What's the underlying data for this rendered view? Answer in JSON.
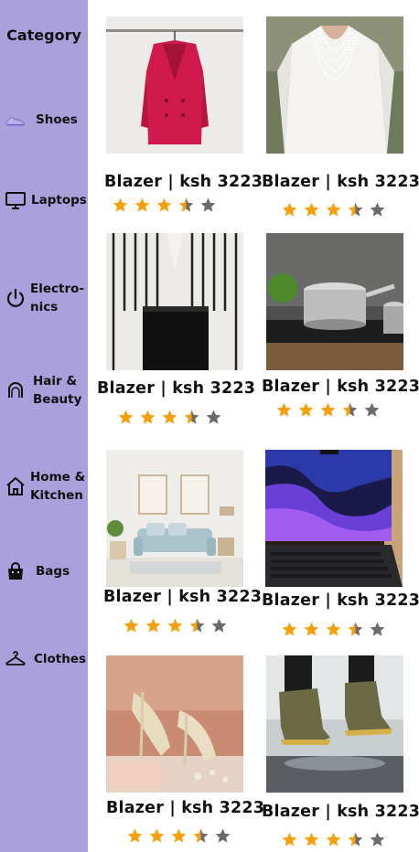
{
  "sidebar": {
    "title": "Category",
    "items": [
      {
        "label": "Shoes",
        "icon": "sneaker-icon"
      },
      {
        "label": "Laptops",
        "icon": "monitor-icon"
      },
      {
        "label": "Electro-\nnics",
        "icon": "power-icon"
      },
      {
        "label": "Hair &\nBeauty",
        "icon": "hair-dryer-icon"
      },
      {
        "label": "Home &\nKitchen",
        "icon": "home-icon"
      },
      {
        "label": "Bags",
        "icon": "bag-icon"
      },
      {
        "label": "Clothes",
        "icon": "hanger-icon"
      }
    ]
  },
  "products": [
    {
      "title": "Blazer  |  ksh 3223",
      "rating": 3.5,
      "image": "red-blazer"
    },
    {
      "title": "Blazer  |  ksh 3223",
      "rating": 3.5,
      "image": "pearl-necklace"
    },
    {
      "title": "Blazer  |  ksh 3223",
      "rating": 3.5,
      "image": "striped-shirt"
    },
    {
      "title": "Blazer  |  ksh 3223",
      "rating": 3.5,
      "image": "cooking-pot"
    },
    {
      "title": "Blazer  |  ksh 3223",
      "rating": 3.5,
      "image": "living-room"
    },
    {
      "title": "Blazer  |  ksh 3223",
      "rating": 3.5,
      "image": "laptop"
    },
    {
      "title": "Blazer  |  ksh 3223",
      "rating": 3.5,
      "image": "heels"
    },
    {
      "title": "Blazer  |  ksh 3223",
      "rating": 3.5,
      "image": "sneakers"
    }
  ],
  "colors": {
    "sidebar_bg": "#a9a0dc",
    "star_filled": "#f5a10f",
    "star_empty": "#6b6b6b"
  }
}
